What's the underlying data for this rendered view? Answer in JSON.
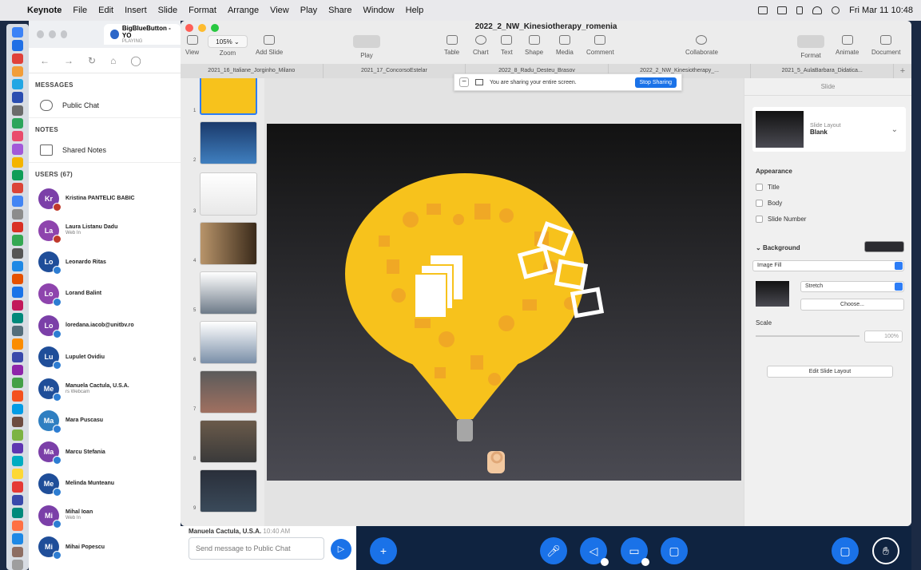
{
  "menubar": {
    "items": [
      "Keynote",
      "File",
      "Edit",
      "Insert",
      "Slide",
      "Format",
      "Arrange",
      "View",
      "Play",
      "Share",
      "Window",
      "Help"
    ],
    "datetime": "Fri Mar 11  10:48"
  },
  "browser": {
    "tab_title": "BigBlueButton - YO",
    "tab_subtitle": "PLAYING"
  },
  "bbb": {
    "messages_heading": "MESSAGES",
    "public_chat": "Public Chat",
    "notes_heading": "NOTES",
    "shared_notes": "Shared Notes",
    "users_heading": "USERS (67)",
    "users": [
      {
        "initials": "Kr",
        "name": "Kristina PANTELIC BABIC",
        "sub": "",
        "color": "#7b3fa8",
        "badge": "#c0392b"
      },
      {
        "initials": "La",
        "name": "Laura Listanu Dadu",
        "sub": "Web In",
        "color": "#8e44ad",
        "badge": "#c0392b"
      },
      {
        "initials": "Lo",
        "name": "Leonardo Ritas",
        "sub": "",
        "color": "#1f4e99",
        "badge": "#2d7dd2"
      },
      {
        "initials": "Lo",
        "name": "Lorand Balint",
        "sub": "",
        "color": "#8e44ad",
        "badge": "#2d7dd2"
      },
      {
        "initials": "Lo",
        "name": "loredana.iacob@unitbv.ro",
        "sub": "",
        "color": "#7b3fa8",
        "badge": "#2d7dd2"
      },
      {
        "initials": "Lu",
        "name": "Lupulet Ovidiu",
        "sub": "",
        "color": "#1f4e99",
        "badge": "#2d7dd2"
      },
      {
        "initials": "Me",
        "name": "Manuela Cactula, U.S.A.",
        "sub": "rs Webcam",
        "color": "#1f4e99",
        "badge": "#2d7dd2"
      },
      {
        "initials": "Ma",
        "name": "Mara Puscasu",
        "sub": "",
        "color": "#2f7fc1",
        "badge": "#2d7dd2"
      },
      {
        "initials": "Ma",
        "name": "Marcu Stefania",
        "sub": "",
        "color": "#7b3fa8",
        "badge": "#2d7dd2"
      },
      {
        "initials": "Me",
        "name": "Melinda Munteanu",
        "sub": "",
        "color": "#1f4e99",
        "badge": "#2d7dd2"
      },
      {
        "initials": "Mi",
        "name": "Mihal Ioan",
        "sub": "Web In",
        "color": "#7b3fa8",
        "badge": "#2d7dd2"
      },
      {
        "initials": "Mi",
        "name": "Mihai Popescu",
        "sub": "",
        "color": "#1f4e99",
        "badge": "#2d7dd2"
      }
    ],
    "chat_peek": "Manuela Cactula, U.S.A.",
    "chat_time": "10:40 AM",
    "chat_placeholder": "Send message to Public Chat"
  },
  "keynote": {
    "doc_title": "2022_2_NW_Kinesiotherapy_romenia",
    "toolbar": {
      "view": "View",
      "zoom": "Zoom",
      "zoom_value": "105%",
      "add_slide": "Add Slide",
      "play": "Play",
      "table": "Table",
      "chart": "Chart",
      "text": "Text",
      "shape": "Shape",
      "media": "Media",
      "comment": "Comment",
      "collaborate": "Collaborate",
      "format": "Format",
      "animate": "Animate",
      "document": "Document"
    },
    "tabs": [
      "2021_16_Italiane_Jorginho_Milano",
      "2021_17_ConcorsoEstelar",
      "2022_8_Radu_Desteu_Brasov",
      "2022_2_NW_Kinesiotherapy_...",
      "2021_5_AulaBarbara_Didatica..."
    ],
    "sharing_banner": "You are sharing your entire screen.",
    "stop_sharing": "Stop Sharing",
    "slide_numbers": [
      "1",
      "2",
      "3",
      "4",
      "5",
      "6",
      "7",
      "8",
      "9"
    ],
    "inspector": {
      "heading": "Slide",
      "layout_label": "Slide Layout",
      "layout_value": "Blank",
      "appearance": "Appearance",
      "title": "Title",
      "body": "Body",
      "slide_number": "Slide Number",
      "background": "Background",
      "fill_type": "Image Fill",
      "stretch": "Stretch",
      "choose": "Choose...",
      "scale": "Scale",
      "scale_value": "100%",
      "edit_layout": "Edit Slide Layout"
    }
  },
  "colors": {
    "bbb_blue": "#1a72e8",
    "bbb_dark": "#0f2340",
    "bulb_yellow": "#f7c21c",
    "bulb_icon": "#f0a825"
  }
}
